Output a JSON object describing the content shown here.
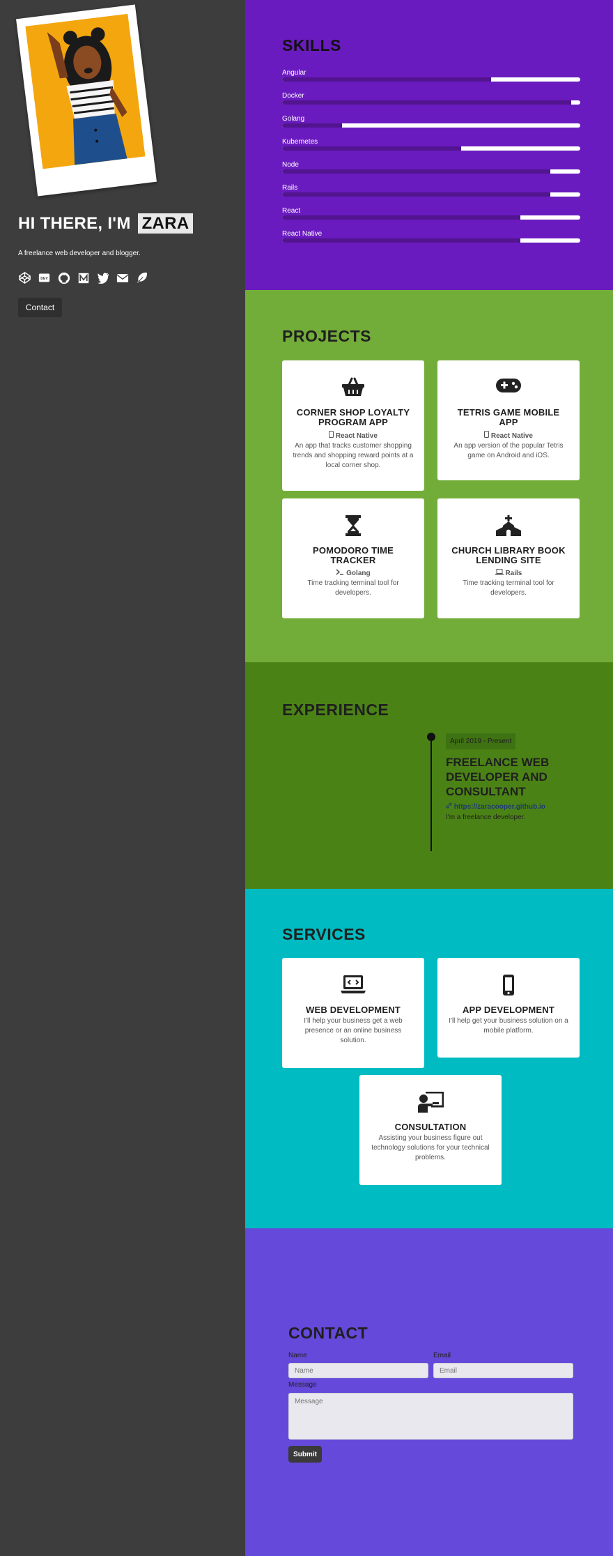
{
  "hero": {
    "greeting": "HI THERE, I'M",
    "name": "ZARA",
    "tagline": "A freelance web developer and blogger.",
    "contact_button": "Contact",
    "social_icons": [
      "codepen-icon",
      "dev-icon",
      "github-icon",
      "medium-icon",
      "twitter-icon",
      "email-icon",
      "feather-icon"
    ]
  },
  "skills": {
    "title": "SKILLS",
    "items": [
      {
        "label": "Angular",
        "level": 0.7
      },
      {
        "label": "Docker",
        "level": 0.97
      },
      {
        "label": "Golang",
        "level": 0.2
      },
      {
        "label": "Kubernetes",
        "level": 0.6
      },
      {
        "label": "Node",
        "level": 0.9
      },
      {
        "label": "Rails",
        "level": 0.9
      },
      {
        "label": "React",
        "level": 0.8
      },
      {
        "label": "React Native",
        "level": 0.8
      }
    ]
  },
  "projects": {
    "title": "PROJECTS",
    "items": [
      {
        "icon": "basket-icon",
        "title": "CORNER SHOP LOYALTY PROGRAM APP",
        "tech_icon": "mobile-icon",
        "tech": "React Native",
        "desc": "An app that tracks customer shopping trends and shopping reward points at a local corner shop."
      },
      {
        "icon": "gamepad-icon",
        "title": "TETRIS GAME MOBILE APP",
        "tech_icon": "mobile-icon",
        "tech": "React Native",
        "desc": "An app version of the popular Tetris game on Android and iOS."
      },
      {
        "icon": "hourglass-icon",
        "title": "POMODORO TIME TRACKER",
        "tech_icon": "terminal-icon",
        "tech": "Golang",
        "desc": "Time tracking terminal tool for developers."
      },
      {
        "icon": "church-icon",
        "title": "CHURCH LIBRARY BOOK LENDING SITE",
        "tech_icon": "laptop-icon",
        "tech": "Rails",
        "desc": "Time tracking terminal tool for developers."
      }
    ]
  },
  "experience": {
    "title": "EXPERIENCE",
    "date": "April 2019 - Present",
    "job_title": "FREELANCE WEB DEVELOPER AND CONSULTANT",
    "link": "https://zaracooper.github.io",
    "desc": "I'm a freelance developer."
  },
  "services": {
    "title": "SERVICES",
    "items": [
      {
        "icon": "laptop-code-icon",
        "title": "WEB DEVELOPMENT",
        "desc": "I'll help your business get a web presence or an online business solution."
      },
      {
        "icon": "mobile-icon",
        "title": "APP DEVELOPMENT",
        "desc": "I'll help get your business solution on a mobile platform."
      },
      {
        "icon": "chalkboard-teacher-icon",
        "title": "CONSULTATION",
        "desc": "Assisting your business figure out technology solutions for your technical problems."
      }
    ]
  },
  "contact": {
    "title": "CONTACT",
    "name_label": "Name",
    "name_placeholder": "Name",
    "email_label": "Email",
    "email_placeholder": "Email",
    "message_label": "Message",
    "message_placeholder": "Message",
    "submit": "Submit"
  },
  "colors": {
    "sidebar": "#3d3d3d",
    "skills_bg": "#6a1bbf",
    "projects_bg": "#73ad39",
    "experience_bg": "#4b8216",
    "services_bg": "#00bbc1",
    "contact_bg": "#6449da"
  }
}
